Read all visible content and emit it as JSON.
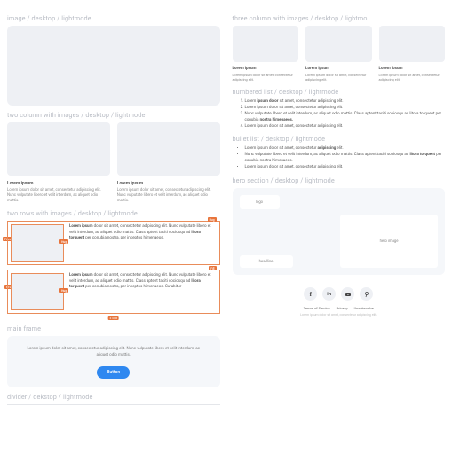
{
  "left": {
    "image": {
      "label": "image / desktop / lightmode"
    },
    "two_col": {
      "label": "two column with images / desktop / lightmode",
      "items": [
        {
          "title": "Lorem ipsum",
          "body": "Lorem ipsum dolor sit amet, consectetur adipiscing elit. Nunc vulputate libero et velit interdum, ac aliquet odio mattis."
        },
        {
          "title": "Lorem ipsum",
          "body": "Lorem ipsum dolor sit amet, consectetur adipiscing elit. Nunc vulputate libero et velit interdum, ac aliquet odio mattis."
        }
      ]
    },
    "two_rows": {
      "label": "two rows with images / desktop / lightmode",
      "rows": [
        "Lorem ipsum dolor sit amet, consectetur adipiscing elit. Nunc vulputate libero et velit interdum, ac aliquet odio mattis. Class aptent taciti sociosqu ad litora torquent per conubia nostra, per inceptos himenaeos.",
        "Lorem ipsum dolor sit amet, consectetur adipiscing elit. Nunc vulputate libero et velit interdum, ac aliquet odio mattis. Class aptent taciti sociosqu ad litora torquent per conubia nostra, per inceptos himenaeos. Curabitur"
      ],
      "tags": {
        "fixed": "Fixed",
        "hug": "Hug",
        "fill": "Fill",
        "f10": "F10px",
        "w410": "410px"
      }
    },
    "main_frame": {
      "label": "main frame",
      "body": "Lorem ipsum dolor sit amet, consectetur adipiscing elit. Nunc vulputate libero et velit interdum, ac aliquet odio mattis.",
      "button": "Button"
    },
    "divider": {
      "label": "divider / dekstop / lightmode"
    }
  },
  "right": {
    "three_col": {
      "label": "three column with images / desktop / lightmo...",
      "items": [
        {
          "title": "Lorem ipsum",
          "body": "Lorem ipsum dolor sit amet, consectetur adipiscing elit."
        },
        {
          "title": "Lorem ipsum",
          "body": "Lorem ipsum dolor sit amet, consectetur adipiscing elit."
        },
        {
          "title": "Lorem ipsum",
          "body": "Lorem ipsum dolor sit amet, consectetur adipiscing elit."
        }
      ]
    },
    "numbered": {
      "label": "numbered list / desktop / lightmode"
    },
    "bullet": {
      "label": "bullet list / desktop / lightmode"
    },
    "hero": {
      "label": "hero section / desktop / lightmode",
      "logo": "logo",
      "headline": "headline",
      "image": "hero image"
    },
    "footer": {
      "links": {
        "tos": "Terms of Service",
        "privacy": "Privacy",
        "unsub": "Unsubscribe"
      },
      "sub": "Lorem ipsum dolor sit amet, consectetur adipiscing elit."
    }
  }
}
